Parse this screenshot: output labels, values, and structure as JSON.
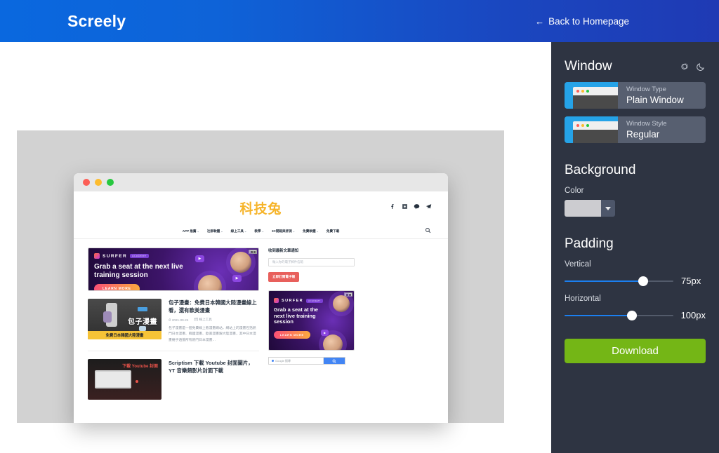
{
  "header": {
    "brand": "Screely",
    "back_label": "Back to Homepage",
    "back_arrow": "←",
    "gradient_from": "#0a68df",
    "gradient_to": "#1f3ab4"
  },
  "panel": {
    "window_section_title": "Window",
    "mode_icons": [
      {
        "name": "light-mode-icon",
        "glyph": "sun"
      },
      {
        "name": "dark-mode-icon",
        "glyph": "moon"
      }
    ],
    "options": [
      {
        "label": "Window Type",
        "value": "Plain Window"
      },
      {
        "label": "Window Style",
        "value": "Regular"
      }
    ],
    "background_section_title": "Background",
    "color_label": "Color",
    "color_value": "#ccccd0",
    "padding_section_title": "Padding",
    "sliders": [
      {
        "label": "Vertical",
        "value": "75px",
        "percent": 72
      },
      {
        "label": "Horizontal",
        "value": "100px",
        "percent": 62
      }
    ],
    "download_label": "Download",
    "download_color": "#74b616",
    "accent_color": "#1b7ff0",
    "panel_bg": "#2e3442"
  },
  "canvas": {
    "background_color": "#d2d2d2",
    "window_dots": [
      "#fc5f57",
      "#fdbc2e",
      "#28c840"
    ]
  },
  "site": {
    "logo": "科技兔",
    "socials": [
      "facebook-icon",
      "instagram-icon",
      "line-icon",
      "telegram-icon"
    ],
    "nav": [
      {
        "label": "APP 推薦",
        "caret": "⌄"
      },
      {
        "label": "社群軟體",
        "caret": "⌄"
      },
      {
        "label": "線上工具",
        "caret": "⌄"
      },
      {
        "label": "教學",
        "caret": "⌄"
      },
      {
        "label": "3C開箱與評測",
        "caret": "⌄"
      },
      {
        "label": "免費軟體",
        "caret": "⌄"
      },
      {
        "label": "免費下載",
        "caret": ""
      }
    ],
    "ad": {
      "brand": "SURFER",
      "tag": "ACADEMY",
      "headline_h": "Grab a seat at the next live training session",
      "headline_v": "Grab a seat at the next live training session",
      "cta": "LEARN MORE"
    },
    "posts": [
      {
        "title": "包子漫畫：免費日本韓國大陸漫畫線上看，還有歐美漫畫",
        "date": "2021-09-24",
        "category": "線上工具",
        "excerpt": "包子漫畫是一個免費線上看漫畫網站，網站上的漫畫包括熱門日本漫畫、韓國漫畫、歐美漫畫跟大陸漫畫，其中日本漫畫幾乎涵蓋所有熱門日本漫畫…",
        "thumb_text": "包子漫畫",
        "thumb_band": "免費日本韓國大陸漫畫"
      },
      {
        "title": "Scriptism 下載 Youtube 封面圖片，YT 音樂頻影片封面下載",
        "thumb_text": "下載 Youtube 封面"
      }
    ],
    "widget": {
      "title": "收到最新文章通知",
      "input_placeholder": "輸入你的電子郵件信箱",
      "button": "立即訂閱電子報"
    },
    "gcse": {
      "placeholder": "Google 搜尋",
      "button_icon": "search-icon"
    }
  }
}
